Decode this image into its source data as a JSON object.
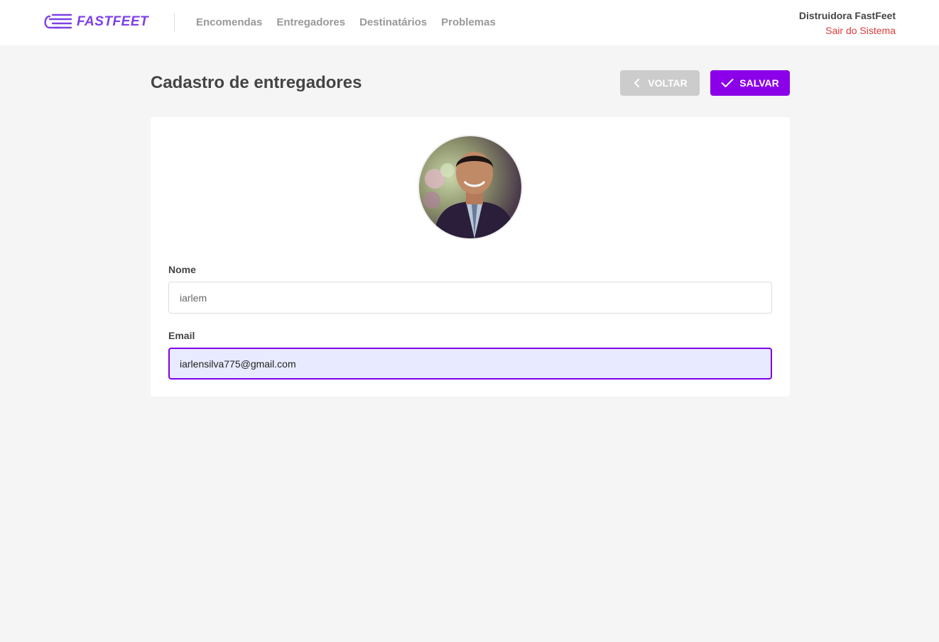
{
  "header": {
    "logo_text": "FASTFEET",
    "nav": [
      {
        "label": "Encomendas"
      },
      {
        "label": "Entregadores"
      },
      {
        "label": "Destinatários"
      },
      {
        "label": "Problemas"
      }
    ],
    "user_name": "Distruidora FastFeet",
    "logout_label": "Sair do Sistema"
  },
  "page": {
    "title": "Cadastro de entregadores",
    "back_label": "VOLTAR",
    "save_label": "SALVAR"
  },
  "form": {
    "name_label": "Nome",
    "name_value": "iarlem",
    "email_label": "Email",
    "email_value": "iarlensilva775@gmail.com"
  },
  "colors": {
    "brand": "#7d40e7",
    "save_button": "#8b00e8",
    "back_button": "#cccccc",
    "logout": "#de3b3b"
  },
  "icons": {
    "logo": "fast-delivery-icon",
    "back": "chevron-left-icon",
    "save": "check-icon"
  }
}
